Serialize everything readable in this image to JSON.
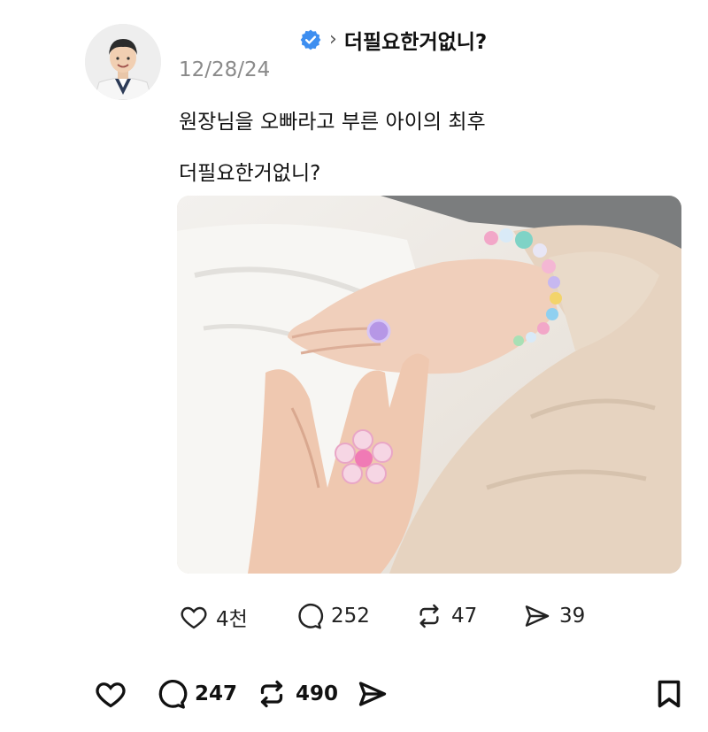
{
  "post": {
    "header_title": "더필요한거없니?",
    "date": "12/28/24",
    "text_line1": "원장님을 오빠라고 부른 아이의 최후",
    "text_line2": "더필요한거없니?"
  },
  "inner_actions": {
    "likes": "4천",
    "comments": "252",
    "reposts": "47",
    "shares": "39"
  },
  "bottom_bar": {
    "comments": "247",
    "reposts": "490"
  },
  "colors": {
    "verified": "#3d8ef0",
    "text": "#111111",
    "muted": "#8a8a8a"
  },
  "icons": [
    "verified-badge-icon",
    "chevron-right-icon",
    "heart-icon",
    "comment-icon",
    "repost-icon",
    "send-icon",
    "bookmark-icon"
  ]
}
